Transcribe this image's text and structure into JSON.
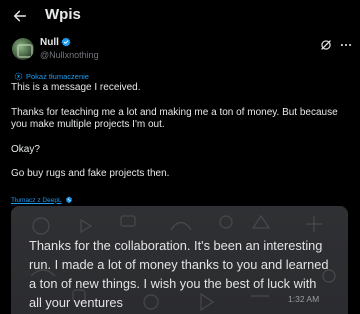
{
  "header": {
    "title": "Wpis"
  },
  "author": {
    "display_name": "Null",
    "handle": "@Nullxnothing",
    "verified_color": "#1d9bf0"
  },
  "translation": {
    "show_label": "Pokaż tłumaczenie",
    "translated_by": "Tłumacz z DeepL"
  },
  "tweet": {
    "paragraphs": [
      "This is a message I received.",
      "Thanks for teaching me a lot and making me a ton of money. But because you make multiple projects I'm out.",
      "Okay?",
      "Go buy rugs and fake projects then."
    ]
  },
  "image_message": {
    "text": "Thanks for the collaboration. It's been an interesting run. I made a lot of money thanks to you and learned a ton of new things. I wish you the best of luck with all your ventures",
    "time": "1:32 AM"
  },
  "colors": {
    "background": "#000000",
    "text": "#e7e9ea",
    "secondary": "#71767b",
    "accent": "#1d9bf0",
    "message_bg": "#2f3033"
  }
}
